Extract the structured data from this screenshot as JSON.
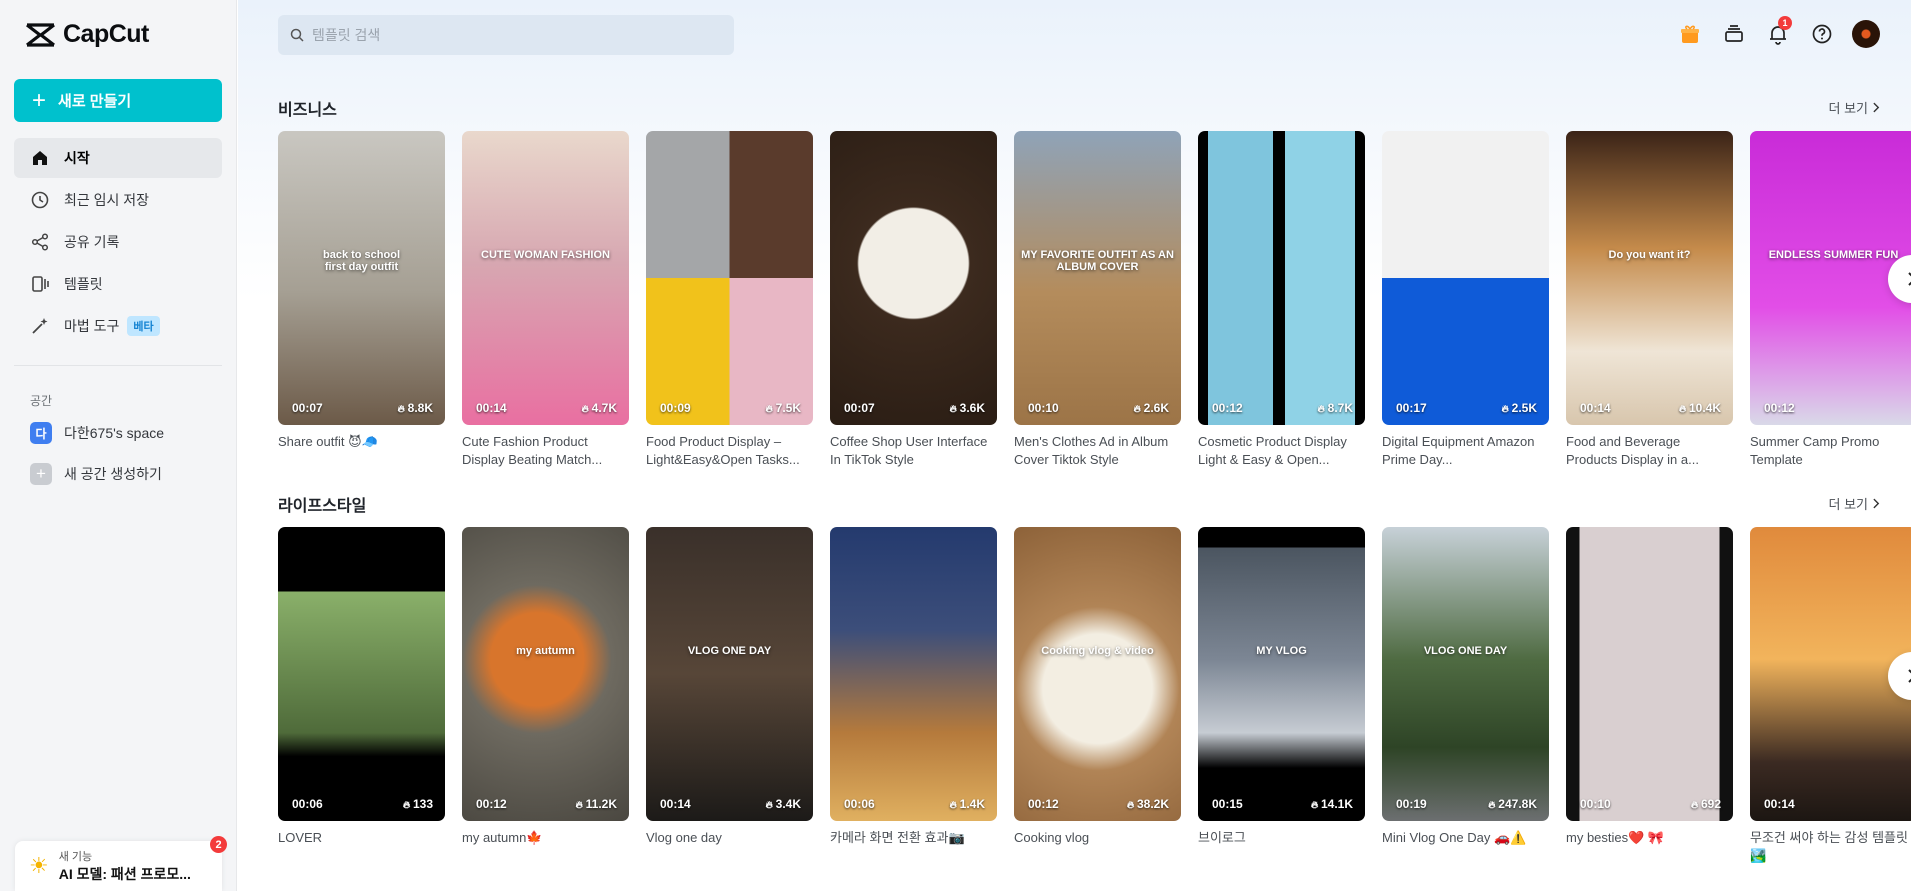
{
  "app": {
    "name": "CapCut"
  },
  "sidebar": {
    "create_label": "새로 만들기",
    "items": [
      {
        "label": "시작",
        "icon": "home-icon"
      },
      {
        "label": "최근 임시 저장",
        "icon": "clock-icon"
      },
      {
        "label": "공유 기록",
        "icon": "share-icon"
      },
      {
        "label": "템플릿",
        "icon": "template-icon"
      },
      {
        "label": "마법 도구",
        "icon": "magic-wand-icon",
        "badge": "베타"
      }
    ],
    "space_title": "공간",
    "space_avatar": "다",
    "space_name": "다한675's space",
    "new_space_label": "새 공간 생성하기",
    "feature": {
      "small": "새 기능",
      "big": "AI 모델: 패션 프로모...",
      "badge": "2"
    }
  },
  "header": {
    "search_placeholder": "템플릿 검색",
    "notification_count": "1",
    "icons": [
      "gift-icon",
      "layers-icon",
      "bell-icon",
      "help-icon",
      "avatar"
    ]
  },
  "sections": [
    {
      "title": "비즈니스",
      "more": "더 보기",
      "cards": [
        {
          "title": "Share outfit 😈🧢",
          "duration": "00:07",
          "uses": "8.8K",
          "overlay": "back to school\nfirst day outfit",
          "bg": "linear-gradient(180deg,#c9c7c1 0%,#a59f93 55%,#6c5a48 100%)"
        },
        {
          "title": "Cute Fashion Product Display Beating Match...",
          "duration": "00:14",
          "uses": "4.7K",
          "overlay": "CUTE WOMAN FASHION",
          "bg": "linear-gradient(180deg,#e9d8cc 0%,#d7a7b1 45%,#e96fa1 100%)"
        },
        {
          "title": "Food Product Display – Light&Easy&Open Tasks...",
          "duration": "00:09",
          "uses": "7.5K",
          "overlay": "",
          "bg": "conic-gradient(from 0deg at 50% 50%,#5a3b2c 0 25%,#e8b7c5 25% 50%,#f1c21b 50% 75%,#a4a6a8 75% 100%)"
        },
        {
          "title": "Coffee Shop User Interface In TikTok Style",
          "duration": "00:07",
          "uses": "3.6K",
          "overlay": "",
          "bg": "radial-gradient(circle at 50% 45%,#f2eee6 0 30%,#3c2a1e 31%,#2a1d14 100%)"
        },
        {
          "title": "Men's Clothes Ad in Album Cover Tiktok Style",
          "duration": "00:10",
          "uses": "2.6K",
          "overlay": "MY FAVORITE OUTFIT AS AN ALBUM COVER",
          "bg": "linear-gradient(180deg,#8fa3b8 0%,#b48c5c 55%,#9c7447 100%)"
        },
        {
          "title": "Cosmetic Product Display Light & Easy & Open...",
          "duration": "00:12",
          "uses": "8.7K",
          "overlay": "",
          "bg": "linear-gradient(90deg,#000 0 6%,#7fc5dd 6% 45%,#000 45% 52%,#8fd2e6 52% 94%,#000 94%)"
        },
        {
          "title": "Digital Equipment Amazon Prime Day...",
          "duration": "00:17",
          "uses": "2.5K",
          "overlay": "",
          "bg": "linear-gradient(180deg,#f1f1f1 0 50%,#0f5bd8 50% 100%)"
        },
        {
          "title": "Food and Beverage Products Display in a...",
          "duration": "00:14",
          "uses": "10.4K",
          "overlay": "Do you want it?",
          "bg": "linear-gradient(180deg,#3a2317 0%,#c58b4b 40%,#efe5d6 75%,#d8c6ad 100%)"
        },
        {
          "title": "Summer Camp Promo Template",
          "duration": "00:12",
          "uses": "",
          "overlay": "ENDLESS SUMMER FUN",
          "bg": "linear-gradient(180deg,#c92bd8 0%,#e24ee7 60%,#d9d9e8 100%)"
        }
      ]
    },
    {
      "title": "라이프스타일",
      "more": "더 보기",
      "cards": [
        {
          "title": "LOVER",
          "duration": "00:06",
          "uses": "133",
          "overlay": "",
          "bg": "linear-gradient(180deg,#000 0 22%,#8ab06a 22%,#4f6b3a 70%,#000 78%)"
        },
        {
          "title": "my autumn🍁",
          "duration": "00:12",
          "uses": "11.2K",
          "overlay": "my autumn",
          "bg": "radial-gradient(circle at 45% 45%,#d8752c 0 25%,#6e6a60 40%,#4a4740 100%)"
        },
        {
          "title": "Vlog one day",
          "duration": "00:14",
          "uses": "3.4K",
          "overlay": "VLOG ONE DAY",
          "bg": "linear-gradient(180deg,#3a302a 0%,#574638 50%,#1c1a18 100%)"
        },
        {
          "title": "카메라 화면 전환 효과📷",
          "duration": "00:06",
          "uses": "1.4K",
          "overlay": "",
          "bg": "linear-gradient(180deg,#243a6e 0%,#3c4e7a 35%,#b57a3c 70%,#e0b060 100%)"
        },
        {
          "title": "Cooking vlog",
          "duration": "00:12",
          "uses": "38.2K",
          "overlay": "Cooking vlog & video",
          "bg": "radial-gradient(circle at 50% 55%,#f3eee2 0 30%,#b18456 45%,#8d6239 100%)"
        },
        {
          "title": "브이로그",
          "duration": "00:15",
          "uses": "14.1K",
          "overlay": "MY VLOG",
          "bg": "linear-gradient(180deg,#000 0 7%,#4b5560 7%,#7c8694 45%,#c6ccd3 70%,#000 82%)"
        },
        {
          "title": "Mini Vlog One Day 🚗⚠️",
          "duration": "00:19",
          "uses": "247.8K",
          "overlay": "VLOG ONE DAY",
          "bg": "linear-gradient(180deg,#c7d1d8 0%,#4f6b42 45%,#2e4426 75%,#6c6f70 100%)"
        },
        {
          "title": "my besties❤️ 🎀",
          "duration": "00:10",
          "uses": "692",
          "overlay": "",
          "bg": "linear-gradient(90deg,#111 0 8%,#d9cfd0 8% 92%,#111 92%)"
        },
        {
          "title": "무조건 써야 하는 감성 템플릿🏞️",
          "duration": "00:14",
          "uses": "",
          "overlay": "",
          "bg": "linear-gradient(180deg,#e08a3c 0%,#f2b45c 45%,#3b2a22 80%,#1c1612 100%)"
        }
      ]
    }
  ],
  "colors": {
    "accent": "#00c1cd",
    "badge": "#f33b3b",
    "beta_bg": "#bfe6ff",
    "beta_fg": "#1684d3"
  }
}
